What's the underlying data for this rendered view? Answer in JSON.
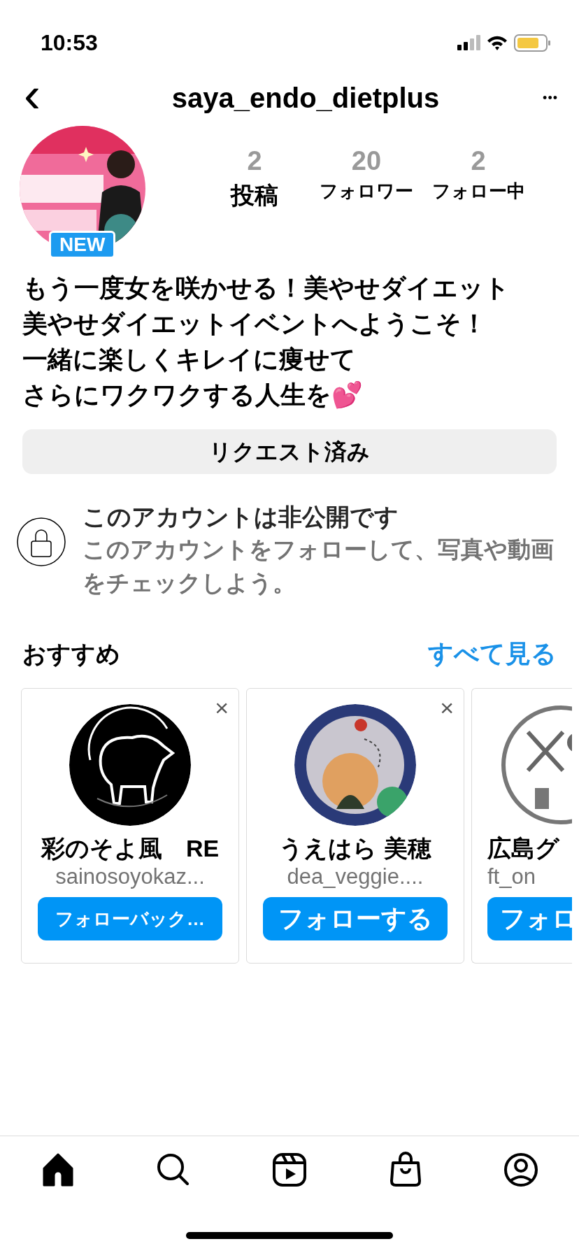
{
  "status_bar": {
    "time": "10:53"
  },
  "header": {
    "back": "‹",
    "title": "saya_endo_dietplus",
    "more": "•••"
  },
  "profile": {
    "badge": "NEW",
    "stats": [
      {
        "value": "2",
        "label": "投稿"
      },
      {
        "value": "20",
        "label": "フォロワー"
      },
      {
        "value": "2",
        "label": "フォロー中"
      }
    ],
    "bio": [
      "もう一度女を咲かせる！美やせダイエット",
      "美やせダイエットイベントへようこそ！",
      "一緒に楽しくキレイに痩せて",
      "さらにワクワクする人生を💕"
    ],
    "request_button": "リクエスト済み"
  },
  "private_notice": {
    "title": "このアカウントは非公開です",
    "text": "このアカウントをフォローして、写真や動画をチェックしよう。"
  },
  "suggestions": {
    "title": "おすすめ",
    "see_all": "すべて見る",
    "cards": [
      {
        "kind": "full",
        "dismiss": "×",
        "name": "彩のそよ風　RE",
        "username": "sainosoyokaz...",
        "button": "フォローバック…"
      },
      {
        "kind": "full",
        "dismiss": "×",
        "name": "うえはら 美穂",
        "username": "dea_veggie....",
        "button": "フォローする"
      },
      {
        "kind": "edge",
        "name": "広島グ",
        "username": "ft_on",
        "button": "フォロ"
      }
    ]
  },
  "tab_bar": {
    "tabs": [
      {
        "kind": "home",
        "selected": true
      },
      {
        "kind": "search",
        "selected": false
      },
      {
        "kind": "reels",
        "selected": false
      },
      {
        "kind": "shop",
        "selected": false
      },
      {
        "kind": "profile",
        "selected": false
      }
    ]
  }
}
